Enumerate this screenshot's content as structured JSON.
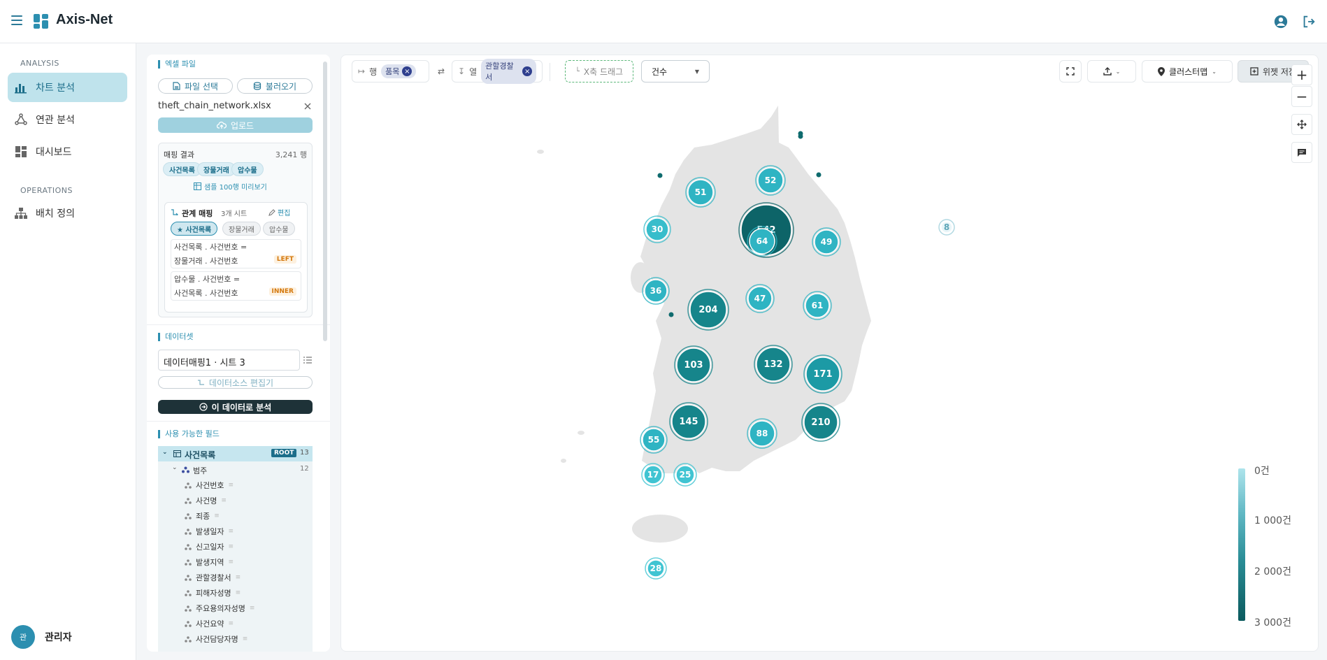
{
  "app": {
    "title": "Axis-Net"
  },
  "nav": {
    "sections": {
      "analysis": "ANALYSIS",
      "operations": "OPERATIONS"
    },
    "items": [
      {
        "label": "차트 분석",
        "icon": "bar-chart-icon",
        "active": true
      },
      {
        "label": "연관 분석",
        "icon": "network-icon",
        "active": false
      },
      {
        "label": "대시보드",
        "icon": "dashboard-icon",
        "active": false
      },
      {
        "label": "배치 정의",
        "icon": "hierarchy-icon",
        "active": false
      }
    ],
    "user": {
      "avatar": "관",
      "name": "관리자"
    }
  },
  "panel": {
    "excel_title": "엑셀 파일",
    "file_select_label": "파일 선택",
    "load_label": "불러오기",
    "file_name": "theft_chain_network.xlsx",
    "upload_label": "업로드",
    "mapping": {
      "title": "매핑 결과",
      "rows": "3,241 행",
      "chips": [
        "사건목록",
        "장물거래",
        "압수물"
      ],
      "sample_link": "샘플 100행 미리보기",
      "relation_title": "관계 매핑",
      "relation_count": "3개 시트",
      "edit_label": "편집",
      "rel_chips": [
        "★ 사건목록",
        "장물거래",
        "압수물"
      ],
      "joins": [
        {
          "line1": "사건목록 . 사건번호 =",
          "line2": "장물거래 . 사건번호",
          "type": "LEFT"
        },
        {
          "line1": "압수물 . 사건번호 =",
          "line2": "사건목록 . 사건번호",
          "type": "INNER"
        }
      ]
    },
    "dataset_title": "데이터셋",
    "dataset_value": "데이터매핑1 · 시트 3",
    "dataset_edit": "데이터소스 편집기",
    "analyze_label": "이 데이터로 분석",
    "fields_title": "사용 가능한 필드",
    "fields": {
      "root_label": "사건목록",
      "root_badge": "ROOT",
      "root_count": "13",
      "group_label": "범주",
      "group_count": "12",
      "items": [
        "사건번호",
        "사건명",
        "죄종",
        "발생일자",
        "신고일자",
        "발생지역",
        "관할경찰서",
        "피해자성명",
        "주요용의자성명",
        "사건요약",
        "사건담당자명"
      ]
    }
  },
  "toolbar": {
    "row_label": "행",
    "row_pill": "품목",
    "col_label": "열",
    "col_pill": "관할경찰서",
    "x_drag": "X축 드래그",
    "measure": "건수",
    "map_type": "클러스터맵",
    "save_label": "위젯 저장"
  },
  "map": {
    "clusters": [
      {
        "value": "542",
        "count": 542
      },
      {
        "value": "52",
        "count": 52
      },
      {
        "value": "51",
        "count": 51
      },
      {
        "value": "30",
        "count": 30
      },
      {
        "value": "64",
        "count": 64
      },
      {
        "value": "49",
        "count": 49
      },
      {
        "value": "36",
        "count": 36
      },
      {
        "value": "47",
        "count": 47
      },
      {
        "value": "204",
        "count": 204
      },
      {
        "value": "61",
        "count": 61
      },
      {
        "value": "103",
        "count": 103
      },
      {
        "value": "132",
        "count": 132
      },
      {
        "value": "171",
        "count": 171
      },
      {
        "value": "145",
        "count": 145
      },
      {
        "value": "88",
        "count": 88
      },
      {
        "value": "210",
        "count": 210
      },
      {
        "value": "55",
        "count": 55
      },
      {
        "value": "17",
        "count": 17
      },
      {
        "value": "25",
        "count": 25
      },
      {
        "value": "28",
        "count": 28
      },
      {
        "value": "8",
        "count": 8
      }
    ],
    "legend": [
      "0건",
      "1 000건",
      "2 000건",
      "3 000건"
    ]
  }
}
